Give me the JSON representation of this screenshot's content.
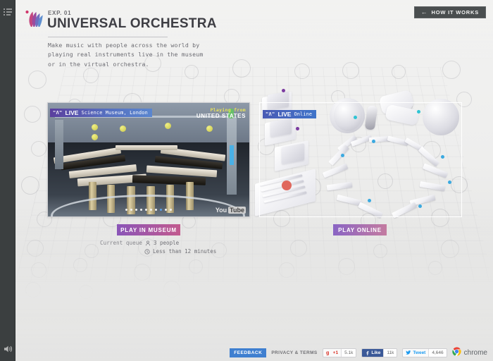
{
  "sidebar": {
    "top_icon": "menu-list-icon",
    "bottom_icon": "volume-speaker-icon"
  },
  "header": {
    "logo_icon": "orchestra-feather-logo",
    "exp_label": "EXP. 01",
    "title": "UNIVERSAL ORCHESTRA",
    "intro": "Make music with people across the world by playing real instruments live in the museum or in the virtual orchestra.",
    "how_it_works": {
      "label": "HOW IT WORKS",
      "arrow_icon": "arrow-left-icon"
    }
  },
  "museum_panel": {
    "badge": {
      "mark": "\"Λ\"",
      "live": "LIVE",
      "place": "Science Museum, London"
    },
    "playing_from": {
      "caption": "Playing from",
      "country": "UNITED STATES"
    },
    "player_logo": {
      "you": "You",
      "tube": "Tube"
    },
    "slide_count": 10,
    "active_slide": 8,
    "cta_label": "PLAY IN MUSEUM",
    "queue": {
      "label": "Current queue",
      "people_icon": "person-icon",
      "people": "3 people",
      "time_icon": "clock-icon",
      "time": "Less than 12 minutes"
    }
  },
  "online_panel": {
    "badge": {
      "mark": "\"Λ\"",
      "live": "LIVE",
      "place": "Online"
    },
    "cta_label": "PLAY ONLINE"
  },
  "footer": {
    "feedback_label": "FEEDBACK",
    "privacy_label": "PRIVACY & TERMS",
    "social": [
      {
        "network": "google-plus",
        "icon": "google-plus-icon",
        "label": "+1",
        "count": "5.1k"
      },
      {
        "network": "facebook",
        "icon": "facebook-icon",
        "label": "Like",
        "count": "11k"
      },
      {
        "network": "twitter",
        "icon": "twitter-bird-icon",
        "label": "Tweet",
        "count": "4,646"
      }
    ],
    "chrome": {
      "icon": "chrome-logo-icon",
      "label": "chrome"
    }
  },
  "colors": {
    "sidebar": "#3b3f40",
    "accent_purple": "#8a55b8",
    "accent_pink": "#c25a8e",
    "badge_blue": "#3f74c9",
    "feedback_blue": "#3f7fd0",
    "background": "#eeeeed"
  }
}
